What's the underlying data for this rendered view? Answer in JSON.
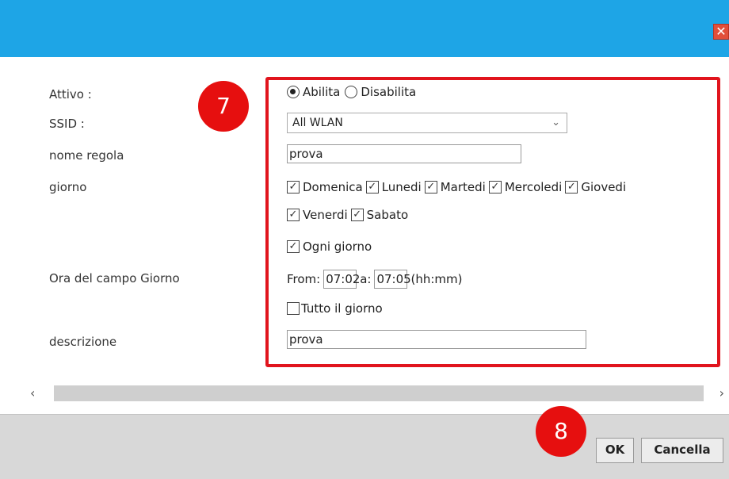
{
  "window": {
    "close_icon": "close-x-icon",
    "titlebar_color": "#1ea5e6"
  },
  "labels": {
    "attivo": "Attivo :",
    "ssid": "SSID :",
    "nome_regola": "nome regola",
    "giorno": "giorno",
    "ora": "Ora del campo Giorno",
    "descrizione": "descrizione"
  },
  "form": {
    "stato": {
      "abilita": "Abilita",
      "disabilita": "Disabilita",
      "selected": "Abilita"
    },
    "ssid_selected": "All WLAN",
    "nome_regola_value": "prova",
    "days": [
      {
        "label": "Domenica",
        "checked": true
      },
      {
        "label": "Lunedi",
        "checked": true
      },
      {
        "label": "Martedi",
        "checked": true
      },
      {
        "label": "Mercoledi",
        "checked": true
      },
      {
        "label": "Giovedi",
        "checked": true
      },
      {
        "label": "Venerdi",
        "checked": true
      },
      {
        "label": "Sabato",
        "checked": true
      }
    ],
    "ogni_giorno": {
      "label": "Ogni giorno",
      "checked": true
    },
    "time": {
      "from_label": "From:",
      "from_value": "07:02",
      "to_label": "a:",
      "to_value": "07:05",
      "format": "(hh:mm)"
    },
    "tutto_il_giorno": {
      "label": "Tutto il giorno",
      "checked": false
    },
    "descrizione_value": "prova"
  },
  "annotations": {
    "badge_7": "7",
    "badge_8": "8",
    "frame_color": "#e1141d"
  },
  "footer": {
    "ok_label": "OK",
    "cancel_label": "Cancella"
  }
}
